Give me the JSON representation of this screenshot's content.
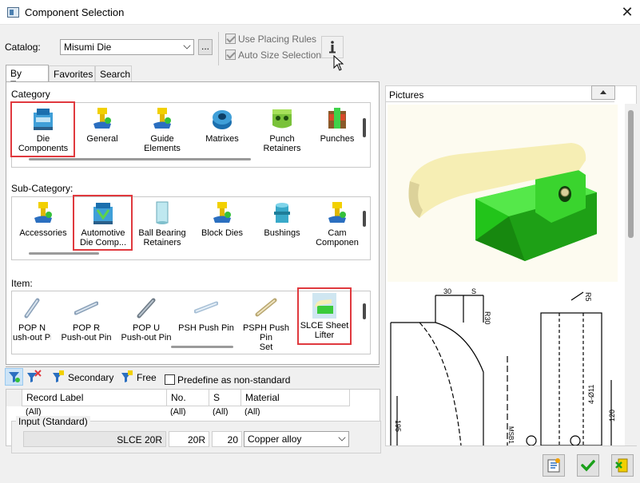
{
  "window": {
    "title": "Component Selection"
  },
  "catalog": {
    "label": "Catalog:",
    "value": "Misumi Die",
    "browse_label": "..."
  },
  "options": {
    "use_placing_rules": "Use Placing Rules",
    "auto_size_selection": "Auto Size Selection",
    "info_label": "i"
  },
  "tabs": [
    {
      "label": "By Type"
    },
    {
      "label": "Favorites"
    },
    {
      "label": "Search"
    }
  ],
  "category": {
    "label": "Category",
    "items": [
      {
        "line1": "Die",
        "line2": "Components",
        "icon": "die-components-icon"
      },
      {
        "line1": "General",
        "line2": "",
        "icon": "general-icon"
      },
      {
        "line1": "Guide",
        "line2": "Elements",
        "icon": "guide-elements-icon"
      },
      {
        "line1": "Matrixes",
        "line2": "",
        "icon": "matrixes-icon"
      },
      {
        "line1": "Punch",
        "line2": "Retainers",
        "icon": "punch-retainers-icon"
      },
      {
        "line1": "Punches",
        "line2": "",
        "icon": "punches-icon"
      }
    ]
  },
  "subcategory": {
    "label": "Sub-Category:",
    "items": [
      {
        "line1": "Accessories",
        "line2": "",
        "icon": "accessories-icon"
      },
      {
        "line1": "Automotive",
        "line2": "Die Comp...",
        "icon": "automotive-die-icon"
      },
      {
        "line1": "Ball Bearing",
        "line2": "Retainers",
        "icon": "ball-bearing-icon"
      },
      {
        "line1": "Block Dies",
        "line2": "",
        "icon": "block-dies-icon"
      },
      {
        "line1": "Bushings",
        "line2": "",
        "icon": "bushings-icon"
      },
      {
        "line1": "Cam",
        "line2": "Componen",
        "icon": "cam-components-icon"
      }
    ]
  },
  "item": {
    "label": "Item:",
    "items": [
      {
        "line1": "POP N",
        "line2": "ush-out Pin",
        "icon": "pin-icon"
      },
      {
        "line1": "POP R",
        "line2": "Push-out Pin",
        "icon": "pin-icon"
      },
      {
        "line1": "POP U",
        "line2": "Push-out Pin",
        "icon": "pin-icon"
      },
      {
        "line1": "PSH Push Pin",
        "line2": "",
        "icon": "pin-icon"
      },
      {
        "line1": "PSPH Push Pin",
        "line2": "Set",
        "icon": "pin-icon"
      },
      {
        "line1": "SLCE Sheet",
        "line2": "Lifter",
        "icon": "sheet-lifter-icon"
      }
    ]
  },
  "bottom_toolbar": {
    "secondary_label": "Secondary",
    "free_label": "Free",
    "predefine_label": "Predefine as non-standard"
  },
  "table": {
    "headers": [
      "Record Label",
      "No.",
      "S",
      "Material"
    ],
    "filter": [
      "(All)",
      "(All)",
      "(All)",
      "(All)"
    ]
  },
  "input": {
    "label": "Input (Standard)",
    "record": "SLCE 20R",
    "no": "20R",
    "s": "20",
    "material": "Copper alloy"
  },
  "pictures": {
    "label": "Pictures",
    "dims": [
      "30",
      "S",
      "R30",
      "R5",
      "195",
      "4-Ø11",
      "120",
      "MSB1"
    ]
  },
  "colors": {
    "selection": "#e0393e",
    "lifter_body": "#33dd22",
    "lifter_arm": "#f6eeb4",
    "ok_green": "#1aa01a"
  }
}
